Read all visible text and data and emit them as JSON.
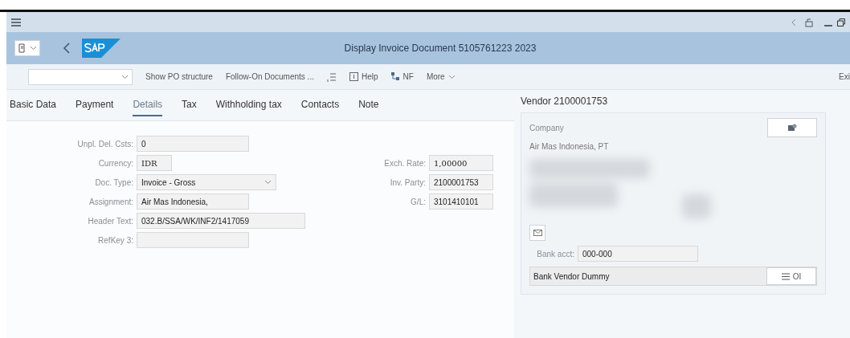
{
  "title_bar": {
    "title": "Display Invoice Document 5105761223 2023"
  },
  "toolbar": {
    "items": [
      {
        "kind": "select"
      },
      {
        "kind": "text",
        "label": "Show PO structure"
      },
      {
        "kind": "text",
        "label": "Follow-On Documents ..."
      },
      {
        "kind": "icon"
      },
      {
        "kind": "help",
        "label": "Help"
      },
      {
        "kind": "hierarchy",
        "label": "NF"
      },
      {
        "kind": "menu",
        "label": "More"
      }
    ],
    "exit": "Exi"
  },
  "tabs": [
    {
      "label": "Basic Data",
      "selected": false
    },
    {
      "label": "Payment",
      "selected": false
    },
    {
      "label": "Details",
      "selected": true
    },
    {
      "label": "Tax",
      "selected": false
    },
    {
      "label": "Withholding tax",
      "selected": false
    },
    {
      "label": "Contacts",
      "selected": false
    },
    {
      "label": "Note",
      "selected": false
    }
  ],
  "fields_left": [
    {
      "label": "Unpl. Del. Csts:",
      "value": "0",
      "kind": "text"
    },
    {
      "label": "Currency:",
      "value": "IDR",
      "kind": "text",
      "mono": true
    },
    {
      "label": "Doc. Type:",
      "value": "Invoice - Gross",
      "kind": "select"
    },
    {
      "label": "Assignment:",
      "value": "Air Mas Indonesia,",
      "kind": "text"
    },
    {
      "label": "Header Text:",
      "value": "032.B/SSA/WK/INF2/1417059",
      "kind": "text"
    },
    {
      "label": "RefKey 3:",
      "kind": "text"
    }
  ],
  "fields_right": [
    {
      "label": "Exch. Rate:",
      "value": "1,00000",
      "mono": true
    },
    {
      "label": "Inv. Party:",
      "value": "2100001753"
    },
    {
      "label": "G/L:",
      "value": "3101410101"
    }
  ],
  "vendor": {
    "title": "Vendor 2100001753",
    "company_label": "Company",
    "name": "Air Mas Indonesia, PT",
    "bank_acct_label": "Bank acct:",
    "bank_acct": "000-000",
    "bank_name": "Bank Vendor Dummy",
    "bank_button": "OI"
  }
}
